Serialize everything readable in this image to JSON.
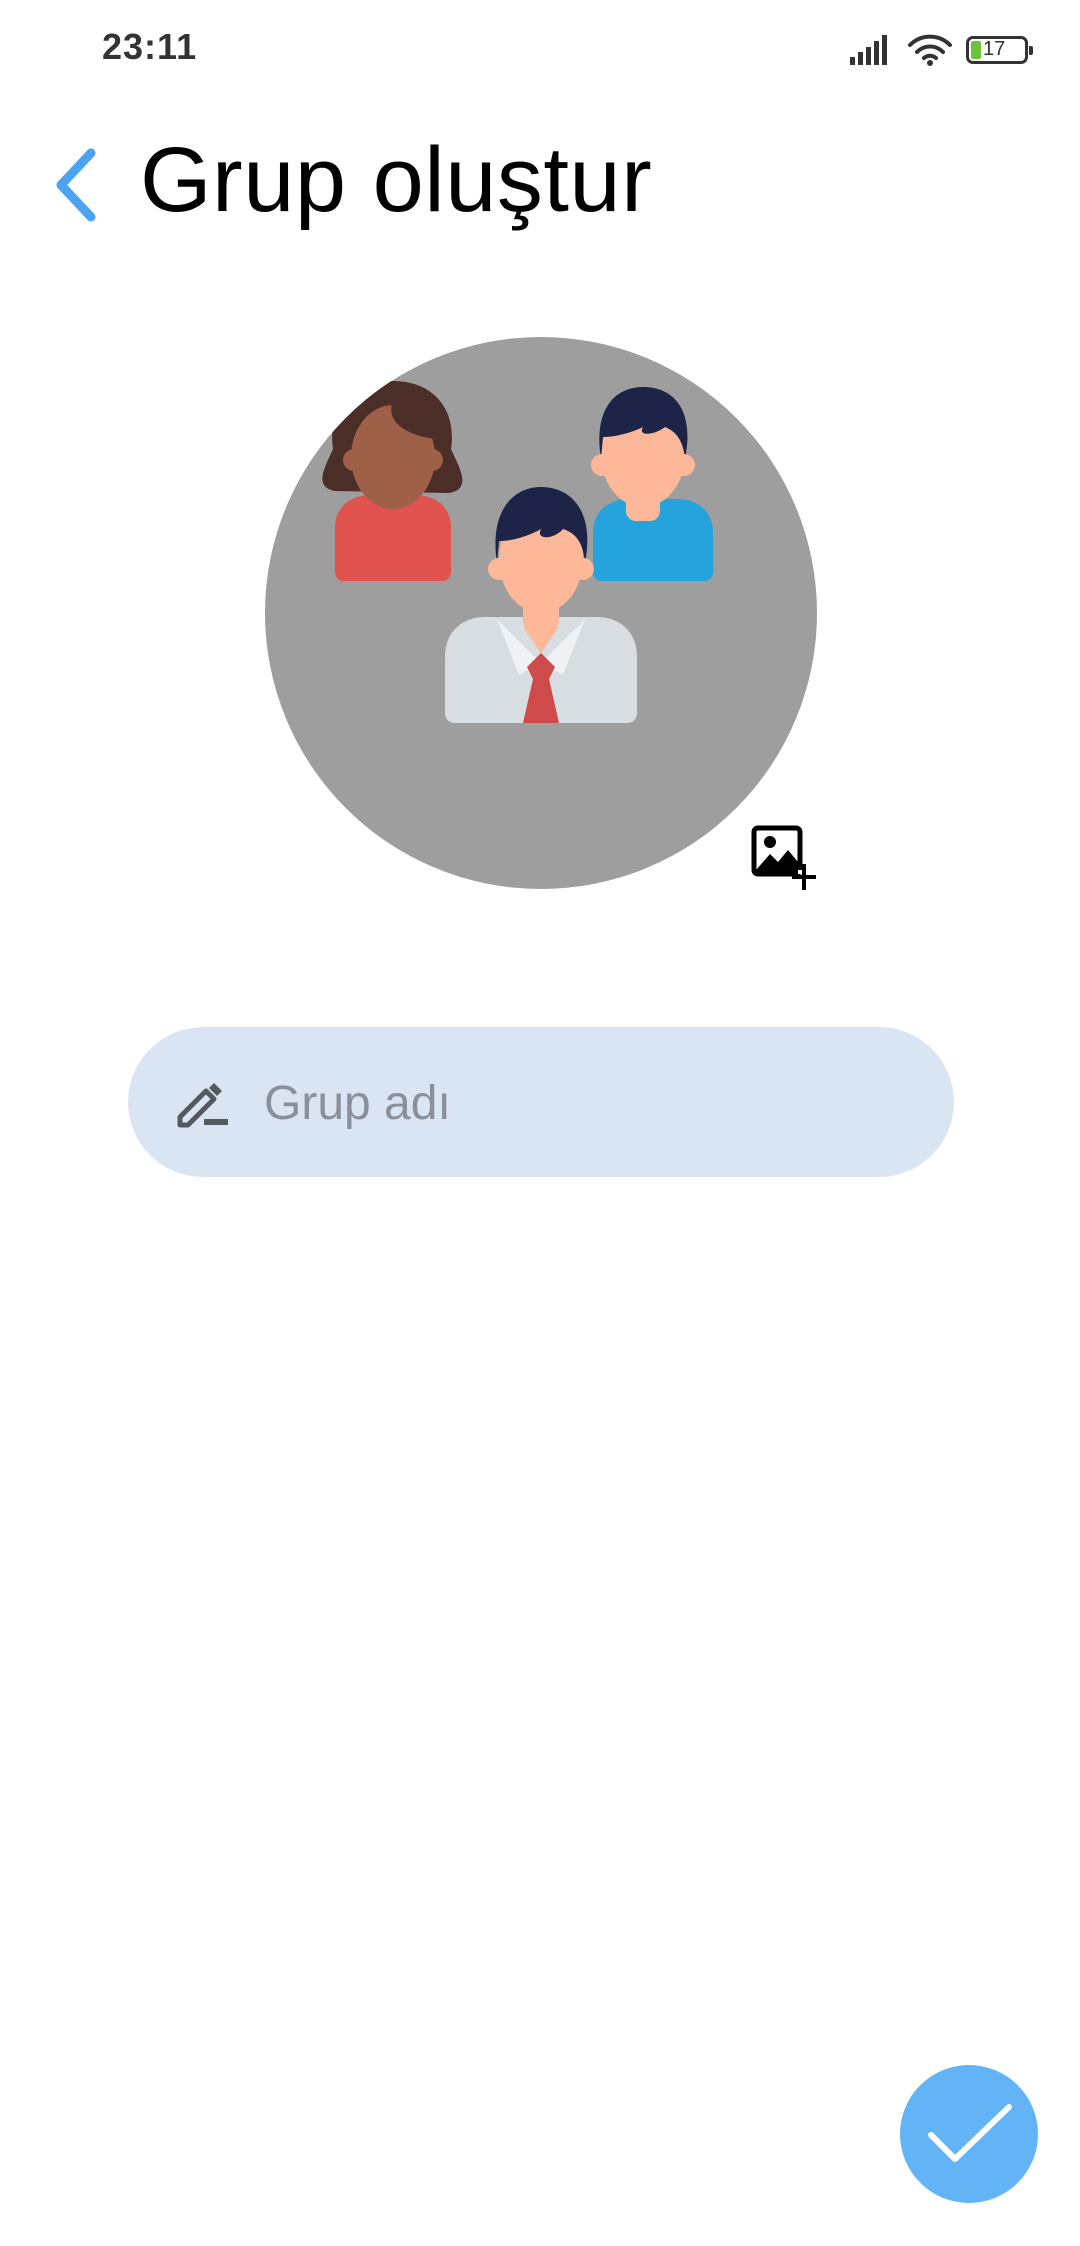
{
  "status_bar": {
    "time": "23:11",
    "battery_level": "17",
    "icons": [
      "signal-icon",
      "wifi-icon",
      "battery-icon"
    ]
  },
  "header": {
    "title": "Grup oluştur",
    "back_icon": "chevron-left-icon"
  },
  "group_photo": {
    "avatar_icon": "group-people-icon",
    "add_photo_icon": "add-image-icon"
  },
  "group_name": {
    "placeholder": "Grup adı",
    "value": "",
    "icon": "pencil-icon"
  },
  "confirm_button": {
    "icon": "checkmark-icon"
  },
  "colors": {
    "accent": "#63b4f6",
    "back_arrow": "#4da3f0",
    "input_background": "#dae5f4",
    "avatar_background": "#9e9e9e"
  }
}
